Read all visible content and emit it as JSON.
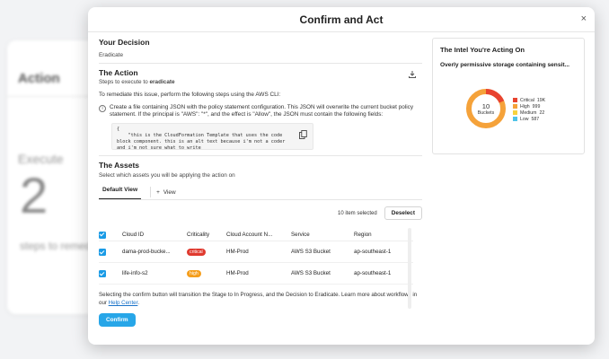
{
  "background": {
    "title": "Action",
    "execute_label": "Execute",
    "number": "2",
    "steps_label": "steps to remediate"
  },
  "modal": {
    "title": "Confirm and Act",
    "close": "×"
  },
  "decision": {
    "title": "Your Decision",
    "value": "Eradicate"
  },
  "action": {
    "title": "The Action",
    "steps_prefix": "Steps to execute to ",
    "steps_target": "eradicate",
    "intro": "To remediate this issue, perform the following steps using the AWS CLI:",
    "step1": "Create a file containing JSON with the policy statement configuration. This JSON will overwrite the current bucket policy statement. If the principal is \"AWS\": \"*\", and the effect is \"Allow\", the JSON must contain the following fields:",
    "code": "{\n    \"this is the CloudFormation Template that uses the code block component. this is an alt text because i'm not a coder and i'm not sure what to write"
  },
  "assets": {
    "title": "The Assets",
    "subtitle": "Select which assets you will be applying the action on",
    "tab_default": "Default View",
    "tab_add": "View",
    "selected_count": "10 item selected",
    "deselect": "Deselect",
    "columns": [
      "Cloud ID",
      "Criticality",
      "Cloud Account N...",
      "Service",
      "Region"
    ],
    "rows": [
      {
        "cloud_id": "dama-prod-bucke...",
        "criticality": "critical",
        "account": "HM-Prod",
        "service": "AWS S3 Bucket",
        "region": "ap-southeast-1"
      },
      {
        "cloud_id": "life-info-s2",
        "criticality": "high",
        "account": "HM-Prod",
        "service": "AWS S3 Bucket",
        "region": "ap-southeast-1"
      }
    ]
  },
  "footer": {
    "text": "Selecting the confirm button will transition the Stage to In Progress, and the Decision to Eradicate. Learn more about workflows in our ",
    "link": "Help Center",
    "end": ".",
    "confirm": "Confirm"
  },
  "intel": {
    "title": "The Intel You're Acting On",
    "subtitle": "Overly permissive storage containing sensit...",
    "center_value": "10",
    "center_label": "Buckets",
    "legend": [
      {
        "label": "Critical",
        "value": "19K",
        "color": "#e8432f"
      },
      {
        "label": "High",
        "value": "999",
        "color": "#f5a23a"
      },
      {
        "label": "Medium",
        "value": "22",
        "color": "#f7d23e"
      },
      {
        "label": "Low",
        "value": "587",
        "color": "#4fc3e8"
      }
    ]
  },
  "colors": {
    "accent": "#27a6e8",
    "critical": "#e03a2f",
    "high": "#f59e1c"
  }
}
